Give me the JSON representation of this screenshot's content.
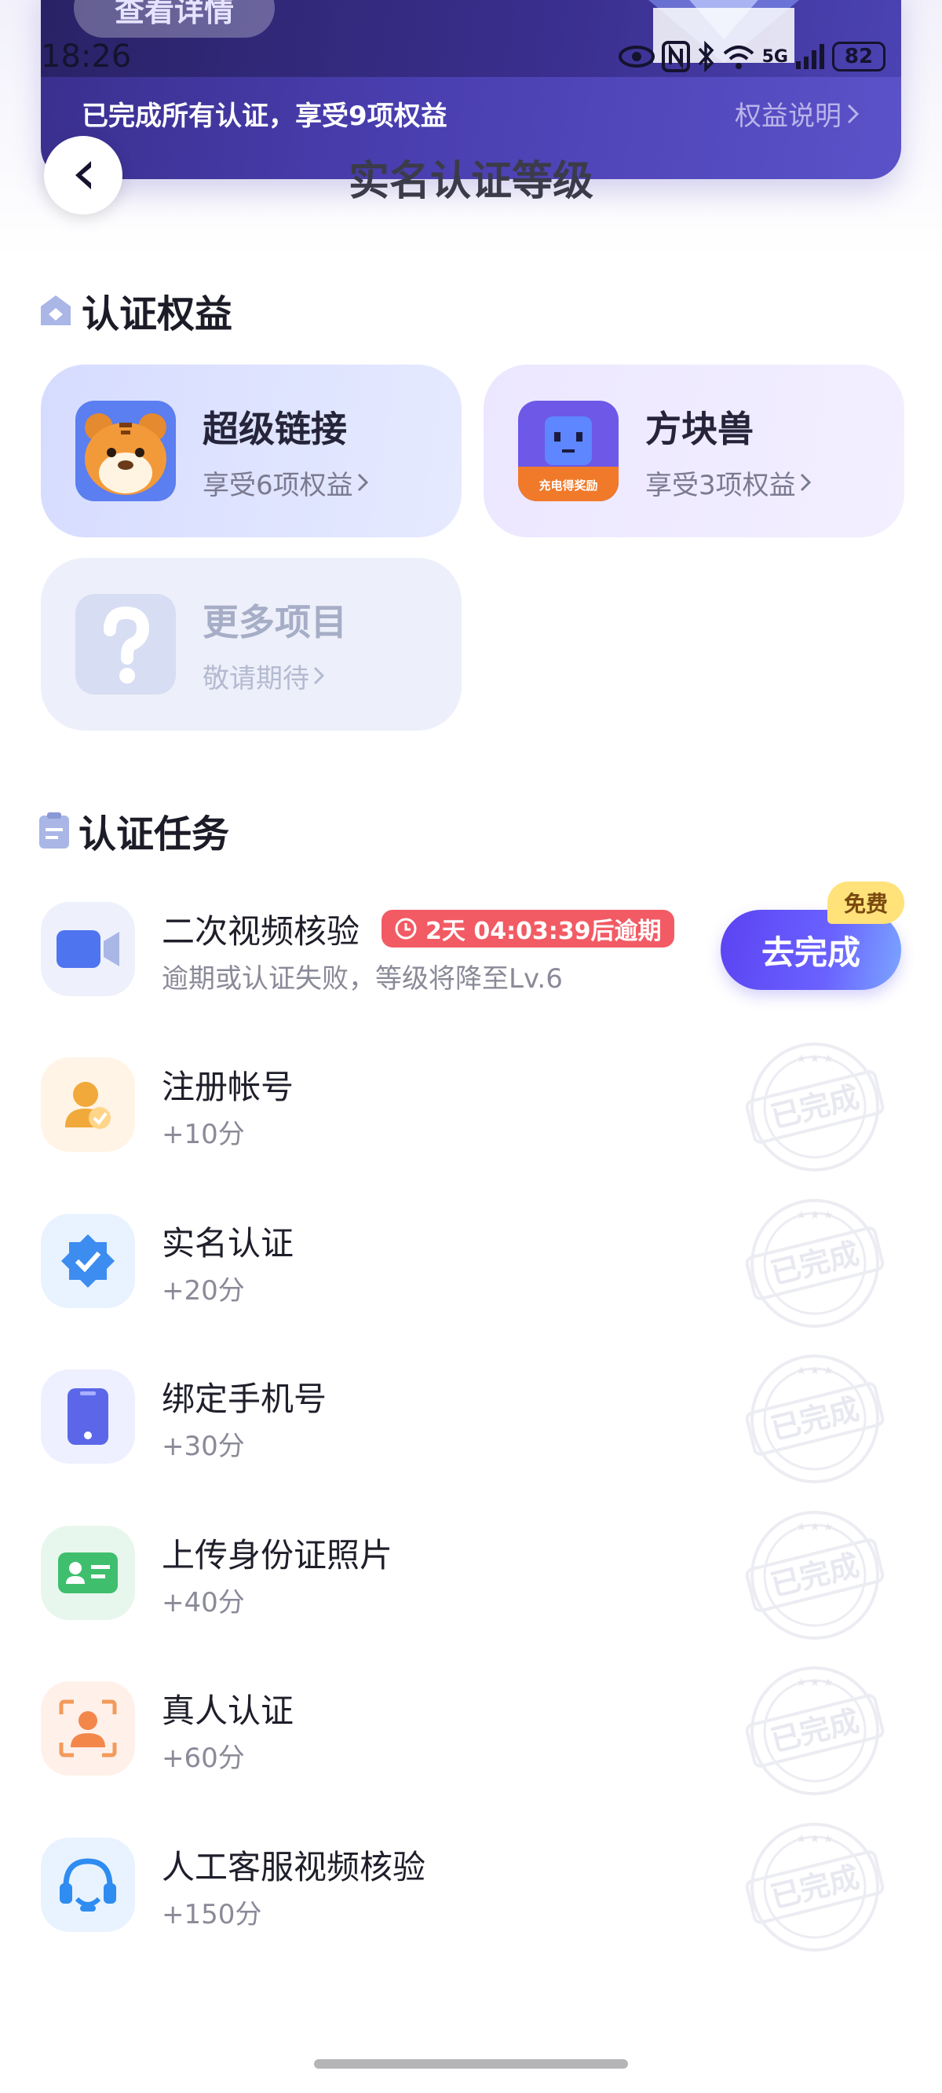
{
  "status_bar": {
    "time": "18:26",
    "battery": "82",
    "signal_label": "5G"
  },
  "banner": {
    "details_button": "查看详情",
    "completed_text": "已完成所有认证，享受9项权益",
    "rights_link": "权益说明"
  },
  "header": {
    "title": "实名认证等级"
  },
  "benefits": {
    "heading": "认证权益",
    "cards": [
      {
        "name": "超级链接",
        "sub": "享受6项权益",
        "icon": "tiger-mascot-icon"
      },
      {
        "name": "方块兽",
        "sub": "享受3项权益",
        "icon": "cube-beast-icon",
        "badge": "充电得奖励"
      },
      {
        "name": "更多项目",
        "sub": "敬请期待",
        "icon": "question-mark-icon"
      }
    ]
  },
  "tasks": {
    "heading": "认证任务",
    "pending": {
      "title": "二次视频核验",
      "deadline": "2天 04:03:39后逾期",
      "desc": "逾期或认证失败，等级将降至Lv.6",
      "button": "去完成",
      "tag": "免费"
    },
    "items": [
      {
        "title": "注册帐号",
        "points": "+10分",
        "icon": "user-check-icon",
        "status": "已完成"
      },
      {
        "title": "实名认证",
        "points": "+20分",
        "icon": "verified-badge-icon",
        "status": "已完成"
      },
      {
        "title": "绑定手机号",
        "points": "+30分",
        "icon": "phone-icon",
        "status": "已完成"
      },
      {
        "title": "上传身份证照片",
        "points": "+40分",
        "icon": "id-card-icon",
        "status": "已完成"
      },
      {
        "title": "真人认证",
        "points": "+60分",
        "icon": "face-scan-icon",
        "status": "已完成"
      },
      {
        "title": "人工客服视频核验",
        "points": "+150分",
        "icon": "headset-icon",
        "status": "已完成"
      }
    ]
  },
  "colors": {
    "accent": "#5b43f2",
    "deadline_red": "#f25b64",
    "banner_purple": "#4a3fb0"
  }
}
